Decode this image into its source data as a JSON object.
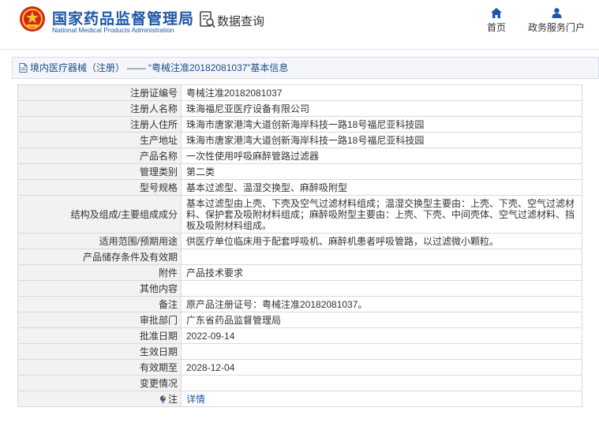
{
  "header": {
    "logo_cn": "国家药品监督管理局",
    "logo_en": "National Medical Products Administration",
    "query_label": "数据查询",
    "nav": [
      {
        "label": "首页",
        "icon": "home-icon"
      },
      {
        "label": "政务服务门户",
        "icon": "user-icon"
      }
    ]
  },
  "breadcrumb": {
    "section": "境内医疗器械（注册）",
    "separator": "——",
    "title": "“粤械注准20182081037”基本信息"
  },
  "rows": [
    {
      "key": "注册证编号",
      "value": "粤械注准20182081037"
    },
    {
      "key": "注册人名称",
      "value": "珠海福尼亚医疗设备有限公司"
    },
    {
      "key": "注册人住所",
      "value": "珠海市唐家港湾大道创新海岸科技一路18号福尼亚科技园"
    },
    {
      "key": "生产地址",
      "value": "珠海市唐家港湾大道创新海岸科技一路18号福尼亚科技园"
    },
    {
      "key": "产品名称",
      "value": "一次性使用呼吸麻醉管路过滤器"
    },
    {
      "key": "管理类别",
      "value": "第二类"
    },
    {
      "key": "型号规格",
      "value": "基本过滤型、温湿交换型、麻醉吸附型"
    },
    {
      "key": "结构及组成/主要组成成分",
      "value": "基本过滤型由上壳、下壳及空气过滤材料组成；温湿交换型主要由：上壳、下壳、空气过滤材料、保护套及吸附材料组成；麻醉吸附型主要由：上壳、下壳、中间壳体、空气过滤材料、挡板及吸附材料组成。"
    },
    {
      "key": "适用范围/预期用途",
      "value": "供医疗单位临床用于配套呼吸机、麻醉机患者呼吸管路，以过滤微小颗粒。"
    },
    {
      "key": "产品储存条件及有效期",
      "value": ""
    },
    {
      "key": "附件",
      "value": "产品技术要求"
    },
    {
      "key": "其他内容",
      "value": ""
    },
    {
      "key": "备注",
      "value": "原产品注册证号：粤械注准20182081037。"
    },
    {
      "key": "审批部门",
      "value": "广东省药品监督管理局"
    },
    {
      "key": "批准日期",
      "value": "2022-09-14"
    },
    {
      "key": "生效日期",
      "value": ""
    },
    {
      "key": "有效期至",
      "value": "2028-12-04"
    },
    {
      "key": "变更情况",
      "value": ""
    }
  ],
  "note_row": {
    "key": "注",
    "link": "详情"
  }
}
